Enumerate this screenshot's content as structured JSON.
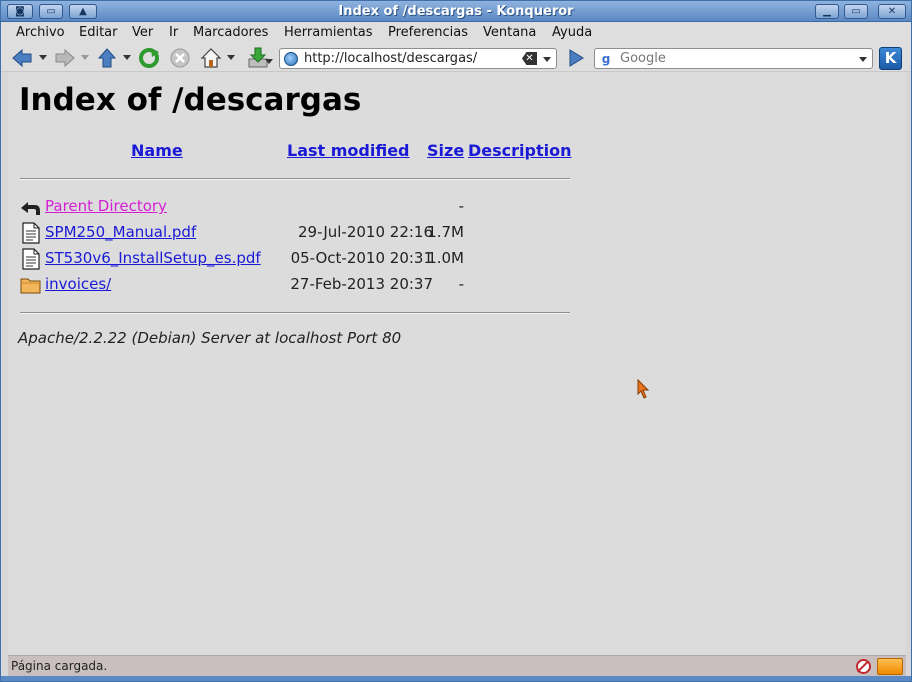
{
  "window": {
    "title": "Index of /descargas - Konqueror"
  },
  "menu": {
    "items": [
      "Archivo",
      "Editar",
      "Ver",
      "Ir",
      "Marcadores",
      "Herramientas",
      "Preferencias",
      "Ventana",
      "Ayuda"
    ]
  },
  "toolbar": {
    "url": "http://localhost/descargas/",
    "search_placeholder": "Google",
    "search_engine_icon": "google-icon"
  },
  "page": {
    "heading": "Index of /descargas",
    "columns": {
      "name": "Name",
      "last_modified": "Last modified",
      "size": "Size",
      "description": "Description"
    },
    "rows": [
      {
        "icon": "back-folder-icon",
        "name": "Parent Directory",
        "modified": "",
        "size": "-",
        "visited": true
      },
      {
        "icon": "document-icon",
        "name": "SPM250_Manual.pdf",
        "modified": "29-Jul-2010 22:16",
        "size": "1.7M",
        "visited": false
      },
      {
        "icon": "document-icon",
        "name": "ST530v6_InstallSetup_es.pdf",
        "modified": "05-Oct-2010 20:31",
        "size": "1.0M",
        "visited": false
      },
      {
        "icon": "folder-icon",
        "name": "invoices/",
        "modified": "27-Feb-2013 20:37",
        "size": "-",
        "visited": false
      }
    ],
    "address": "Apache/2.2.22 (Debian) Server at localhost Port 80"
  },
  "status": {
    "text": "Página cargada."
  },
  "colors": {
    "link": "#1a1ad6",
    "visited_link": "#d51fd5",
    "titlebar": "#5b89c4",
    "background": "#dcdcdc"
  }
}
